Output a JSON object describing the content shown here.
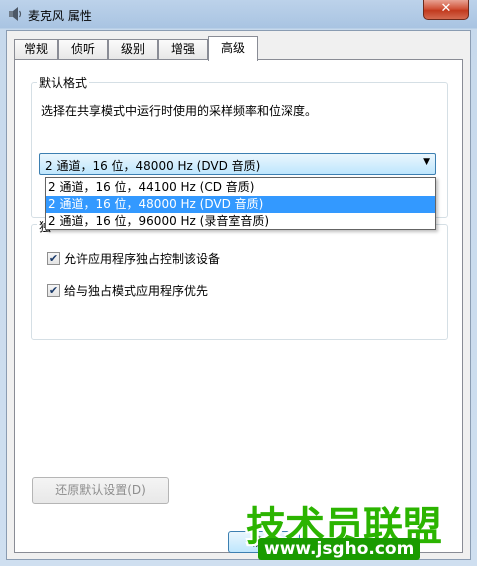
{
  "window": {
    "title": "麦克风 属性",
    "close_label": "✕"
  },
  "tabs": [
    {
      "label": "常规"
    },
    {
      "label": "侦听"
    },
    {
      "label": "级别"
    },
    {
      "label": "增强"
    },
    {
      "label": "高级"
    }
  ],
  "active_tab": "高级",
  "default_format": {
    "group_label": "默认格式",
    "description": "选择在共享模式中运行时使用的采样频率和位深度。",
    "selected": "2 通道，16 位，48000 Hz (DVD 音质)",
    "options": [
      {
        "label": "2 通道，16 位，44100 Hz (CD 音质)",
        "selected": false
      },
      {
        "label": "2 通道，16 位，48000 Hz (DVD 音质)",
        "selected": true
      },
      {
        "label": "2 通道，16 位，96000 Hz (录音室音质)",
        "selected": false
      }
    ]
  },
  "exclusive_mode": {
    "group_label_partial": "独",
    "allow_exclusive": {
      "label": "允许应用程序独占控制该设备",
      "checked": true
    },
    "give_priority": {
      "label": "给与独占模式应用程序优先",
      "checked": true
    }
  },
  "buttons": {
    "restore_defaults": "还原默认设置(D)",
    "ok": "确定"
  },
  "watermark": {
    "title": "技术员联盟",
    "url": "www.jsgho.com"
  },
  "colors": {
    "selection": "#3399ff",
    "watermark_green": "#2bb400"
  }
}
